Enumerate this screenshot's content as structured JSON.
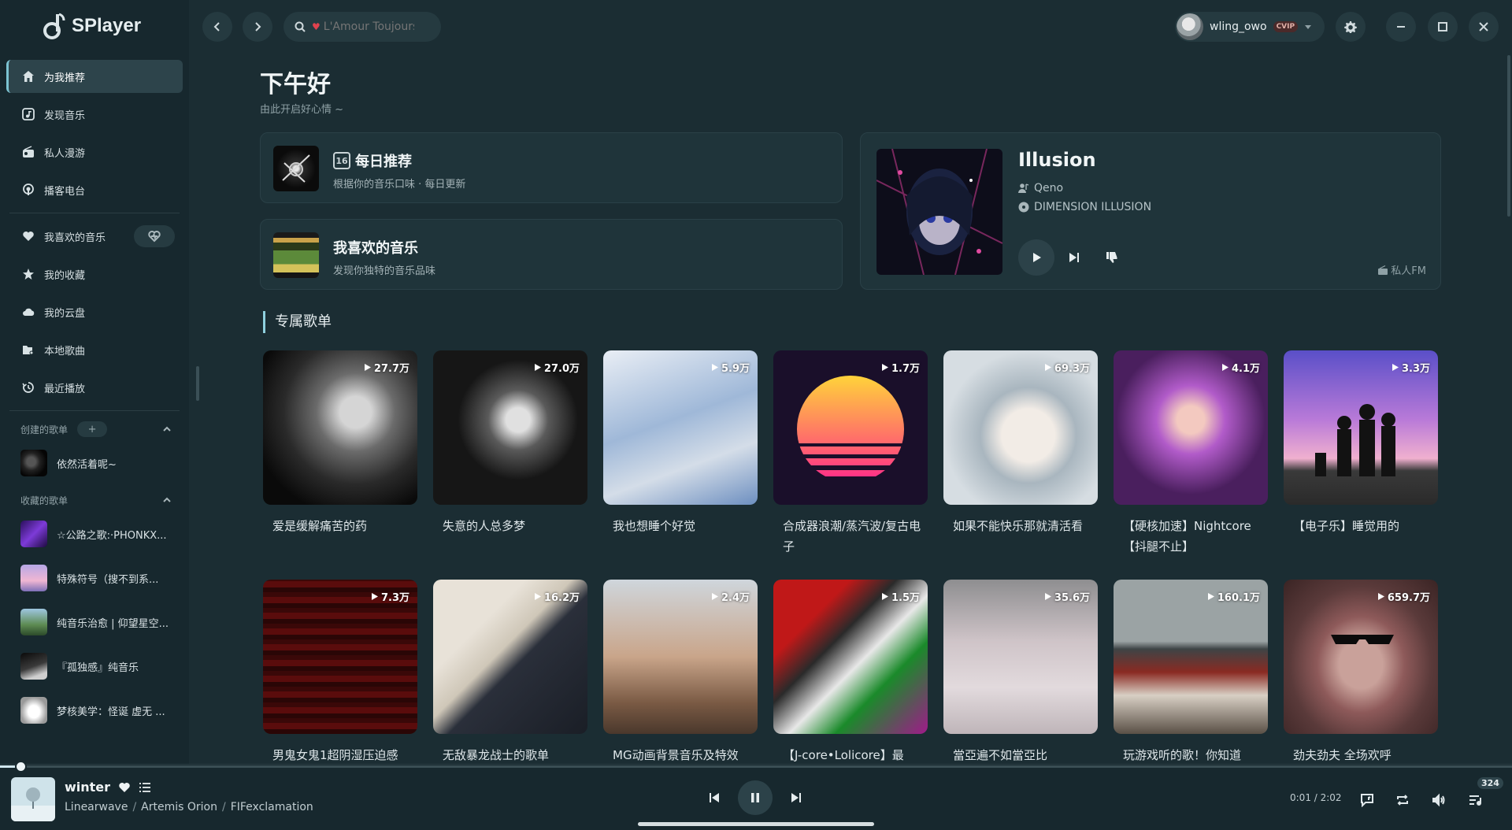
{
  "app": {
    "name": "SPlayer"
  },
  "header": {
    "search_placeholder": "L'Amour Toujours",
    "user": {
      "name": "wling_owo",
      "badge": "CVIP"
    }
  },
  "sidebar": {
    "nav": [
      {
        "label": "为我推荐",
        "icon": "home-icon"
      },
      {
        "label": "发现音乐",
        "icon": "music-note-icon"
      },
      {
        "label": "私人漫游",
        "icon": "radio-icon"
      },
      {
        "label": "播客电台",
        "icon": "podcast-icon"
      }
    ],
    "library": [
      {
        "label": "我喜欢的音乐",
        "icon": "heart-icon"
      },
      {
        "label": "我的收藏",
        "icon": "star-icon"
      },
      {
        "label": "我的云盘",
        "icon": "cloud-icon"
      },
      {
        "label": "本地歌曲",
        "icon": "folder-music-icon"
      },
      {
        "label": "最近播放",
        "icon": "history-icon"
      }
    ],
    "created_header": "创建的歌单",
    "created_add": "+",
    "created": [
      {
        "label": "依然活着呢~"
      }
    ],
    "collected_header": "收藏的歌单",
    "collected": [
      {
        "label": "☆公路之歌:·PHONKX..."
      },
      {
        "label": "特殊符号（搜不到系..."
      },
      {
        "label": "纯音乐治愈 | 仰望星空..."
      },
      {
        "label": "『孤独感』纯音乐"
      },
      {
        "label": "梦核美学：怪诞 虚无 ..."
      }
    ]
  },
  "main": {
    "greeting": "下午好",
    "subgreeting": "由此开启好心情 ~",
    "daily": {
      "title": "每日推荐",
      "calendar_day": "16",
      "desc": "根据你的音乐口味 · 每日更新"
    },
    "liked": {
      "title": "我喜欢的音乐",
      "desc": "发现你独特的音乐品味"
    },
    "fm": {
      "title": "Illusion",
      "artist": "Qeno",
      "album": "DIMENSION ILLUSION",
      "label": "私人FM"
    },
    "section_title": "专属歌单",
    "playlists_row1": [
      {
        "title": "爱是缓解痛苦的药",
        "count": "27.7万"
      },
      {
        "title": "失意的人总多梦",
        "count": "27.0万"
      },
      {
        "title": "我也想睡个好觉",
        "count": "5.9万"
      },
      {
        "title": "合成器浪潮/蒸汽波/复古电子",
        "count": "1.7万"
      },
      {
        "title": "如果不能快乐那就清活看",
        "count": "69.3万"
      },
      {
        "title": "【硬核加速】Nightcore【抖腿不止】",
        "count": "4.1万"
      },
      {
        "title": "【电子乐】睡觉用的",
        "count": "3.3万"
      }
    ],
    "playlists_row2": [
      {
        "title": "男鬼女鬼1超阴湿压迫感",
        "count": "7.3万"
      },
      {
        "title": "无敌暴龙战士的歌单",
        "count": "16.2万"
      },
      {
        "title": "MG动画背景音乐及特效",
        "count": "2.4万"
      },
      {
        "title": "【J-core•Lolicore】最",
        "count": "1.5万"
      },
      {
        "title": "當亞遍不如當亞比",
        "count": "35.6万"
      },
      {
        "title": "玩游戏听的歌！你知道",
        "count": "160.1万"
      },
      {
        "title": "劲夫劲夫 全场欢呼",
        "count": "659.7万"
      }
    ]
  },
  "player": {
    "title": "winter",
    "artists": [
      "Linearwave",
      "Artemis Orion",
      "FIFexclamation"
    ],
    "time": "0:01 / 2:02",
    "progress": 0.008,
    "queue_count": "324"
  },
  "colors": {
    "background": "#1b2d33",
    "sidebar": "#17282e",
    "accent": "#8fd0de",
    "heart": "#e0424e"
  }
}
